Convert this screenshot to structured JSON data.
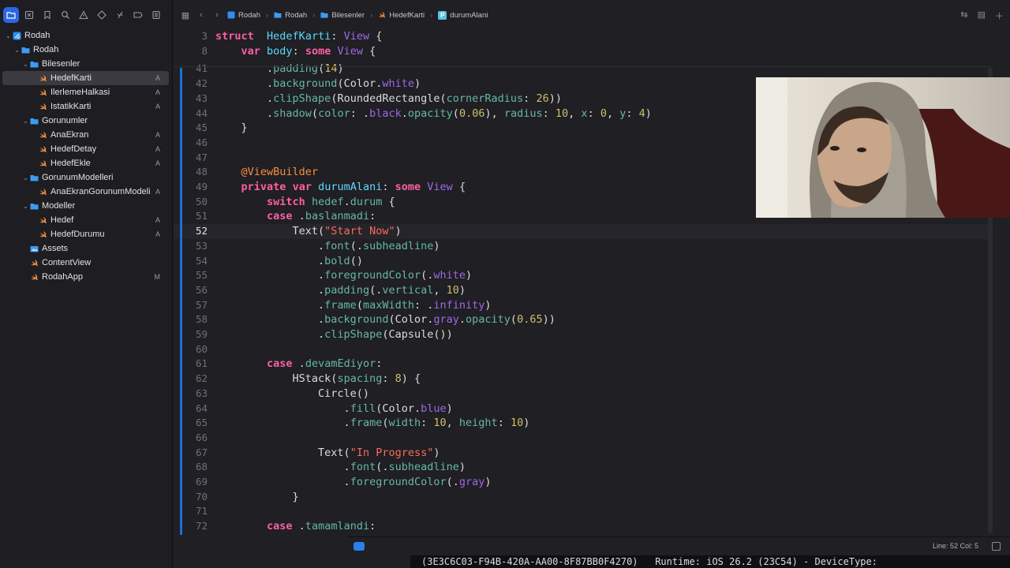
{
  "sidebar": {
    "toolbar_icons": [
      "folder-icon",
      "source-control-icon",
      "bookmark-icon",
      "find-icon",
      "issue-icon",
      "test-icon",
      "debug-icon",
      "breakpoint-icon",
      "report-icon"
    ],
    "tree": [
      {
        "label": "Rodah",
        "depth": 0,
        "kind": "project",
        "disclosure": "v",
        "badge": ""
      },
      {
        "label": "Rodah",
        "depth": 1,
        "kind": "folder",
        "disclosure": "v",
        "badge": ""
      },
      {
        "label": "Bilesenler",
        "depth": 2,
        "kind": "folder",
        "disclosure": "v",
        "badge": ""
      },
      {
        "label": "HedefKarti",
        "depth": 3,
        "kind": "swift",
        "disclosure": "",
        "badge": "A",
        "selected": true
      },
      {
        "label": "IlerlemeHalkasi",
        "depth": 3,
        "kind": "swift",
        "disclosure": "",
        "badge": "A"
      },
      {
        "label": "IstatikKarti",
        "depth": 3,
        "kind": "swift",
        "disclosure": "",
        "badge": "A"
      },
      {
        "label": "Gorunumler",
        "depth": 2,
        "kind": "folder",
        "disclosure": "v",
        "badge": ""
      },
      {
        "label": "AnaEkran",
        "depth": 3,
        "kind": "swift",
        "disclosure": "",
        "badge": "A"
      },
      {
        "label": "HedefDetay",
        "depth": 3,
        "kind": "swift",
        "disclosure": "",
        "badge": "A"
      },
      {
        "label": "HedefEkle",
        "depth": 3,
        "kind": "swift",
        "disclosure": "",
        "badge": "A"
      },
      {
        "label": "GorunumModelleri",
        "depth": 2,
        "kind": "folder",
        "disclosure": "v",
        "badge": ""
      },
      {
        "label": "AnaEkranGorunumModeli",
        "depth": 3,
        "kind": "swift",
        "disclosure": "",
        "badge": "A"
      },
      {
        "label": "Modeller",
        "depth": 2,
        "kind": "folder",
        "disclosure": "v",
        "badge": ""
      },
      {
        "label": "Hedef",
        "depth": 3,
        "kind": "swift",
        "disclosure": "",
        "badge": "A"
      },
      {
        "label": "HedefDurumu",
        "depth": 3,
        "kind": "swift",
        "disclosure": "",
        "badge": "A"
      },
      {
        "label": "Assets",
        "depth": 2,
        "kind": "assets",
        "disclosure": "",
        "badge": ""
      },
      {
        "label": "ContentView",
        "depth": 2,
        "kind": "swift",
        "disclosure": "",
        "badge": ""
      },
      {
        "label": "RodahApp",
        "depth": 2,
        "kind": "swift",
        "disclosure": "",
        "badge": "M"
      }
    ]
  },
  "jumpbar": {
    "crumbs": [
      {
        "label": "Rodah",
        "icon": "project-icon"
      },
      {
        "label": "Rodah",
        "icon": "folder-icon"
      },
      {
        "label": "Bilesenler",
        "icon": "folder-icon"
      },
      {
        "label": "HedefKarti",
        "icon": "swift-file-icon"
      },
      {
        "label": "durumAlani",
        "icon": "property-icon"
      }
    ],
    "property_glyph": "P"
  },
  "editor": {
    "current_line": "52",
    "lines": [
      {
        "n": "3",
        "sticky": true,
        "tokens": [
          [
            "kw",
            "struct"
          ],
          [
            "",
            "  "
          ],
          [
            "decl",
            "HedefKarti"
          ],
          [
            "",
            ": "
          ],
          [
            "ty",
            "View"
          ],
          [
            "",
            " {"
          ]
        ]
      },
      {
        "n": "8",
        "sticky": true,
        "tokens": [
          [
            "",
            "    "
          ],
          [
            "kw",
            "var"
          ],
          [
            "",
            ""
          ],
          [
            "",
            " "
          ],
          [
            "decl",
            "body"
          ],
          [
            "",
            ": "
          ],
          [
            "kw",
            "some"
          ],
          [
            "",
            " "
          ],
          [
            "ty",
            "View"
          ],
          [
            "",
            " {"
          ]
        ]
      },
      {
        "n": "41",
        "tokens": [
          [
            "",
            "        ."
          ],
          [
            "fn",
            "padding"
          ],
          [
            "",
            "("
          ],
          [
            "nm",
            "14"
          ],
          [
            "",
            ")"
          ]
        ]
      },
      {
        "n": "42",
        "tokens": [
          [
            "",
            "        ."
          ],
          [
            "fn",
            "background"
          ],
          [
            "",
            "(Color."
          ],
          [
            "pr",
            "white"
          ],
          [
            "",
            ")"
          ]
        ]
      },
      {
        "n": "43",
        "tokens": [
          [
            "",
            "        ."
          ],
          [
            "fn",
            "clipShape"
          ],
          [
            "",
            "(RoundedRectangle("
          ],
          [
            "fn",
            "cornerRadius"
          ],
          [
            "",
            ": "
          ],
          [
            "nm",
            "26"
          ],
          [
            "",
            "))"
          ]
        ]
      },
      {
        "n": "44",
        "tokens": [
          [
            "",
            "        ."
          ],
          [
            "fn",
            "shadow"
          ],
          [
            "",
            "("
          ],
          [
            "fn",
            "color"
          ],
          [
            "",
            ": ."
          ],
          [
            "pr",
            "black"
          ],
          [
            "",
            "."
          ],
          [
            "fn",
            "opacity"
          ],
          [
            "",
            "("
          ],
          [
            "nm",
            "0.06"
          ],
          [
            "",
            "), "
          ],
          [
            "fn",
            "radius"
          ],
          [
            "",
            ": "
          ],
          [
            "nm",
            "10"
          ],
          [
            "",
            ", "
          ],
          [
            "fn",
            "x"
          ],
          [
            "",
            ": "
          ],
          [
            "nm",
            "0"
          ],
          [
            "",
            ", "
          ],
          [
            "fn",
            "y"
          ],
          [
            "",
            ": "
          ],
          [
            "nm",
            "4"
          ],
          [
            "",
            ")"
          ]
        ]
      },
      {
        "n": "45",
        "tokens": [
          [
            "",
            "    }"
          ]
        ]
      },
      {
        "n": "46",
        "tokens": [
          [
            "",
            ""
          ]
        ]
      },
      {
        "n": "47",
        "tokens": [
          [
            "",
            ""
          ]
        ]
      },
      {
        "n": "48",
        "tokens": [
          [
            "",
            "    "
          ],
          [
            "at",
            "@ViewBuilder"
          ]
        ]
      },
      {
        "n": "49",
        "tokens": [
          [
            "",
            "    "
          ],
          [
            "kw",
            "private"
          ],
          [
            "",
            " "
          ],
          [
            "kw",
            "var"
          ],
          [
            "",
            " "
          ],
          [
            "decl",
            "durumAlani"
          ],
          [
            "",
            ": "
          ],
          [
            "kw",
            "some"
          ],
          [
            "",
            " "
          ],
          [
            "ty",
            "View"
          ],
          [
            "",
            " {"
          ]
        ]
      },
      {
        "n": "50",
        "tokens": [
          [
            "",
            "        "
          ],
          [
            "kw",
            "switch"
          ],
          [
            "",
            " "
          ],
          [
            "fn",
            "hedef"
          ],
          [
            "",
            "."
          ],
          [
            "fn",
            "durum"
          ],
          [
            "",
            " {"
          ]
        ]
      },
      {
        "n": "51",
        "tokens": [
          [
            "",
            "        "
          ],
          [
            "kw",
            "case"
          ],
          [
            "",
            " ."
          ],
          [
            "fn",
            "baslanmadi"
          ],
          [
            "",
            ":"
          ]
        ]
      },
      {
        "n": "52",
        "current": true,
        "tokens": [
          [
            "",
            "            Text("
          ],
          [
            "st",
            "\"Start Now\""
          ],
          [
            "",
            ")"
          ]
        ]
      },
      {
        "n": "53",
        "tokens": [
          [
            "",
            "                ."
          ],
          [
            "fn",
            "font"
          ],
          [
            "",
            "(."
          ],
          [
            "fn",
            "subheadline"
          ],
          [
            "",
            ")"
          ]
        ]
      },
      {
        "n": "54",
        "tokens": [
          [
            "",
            "                ."
          ],
          [
            "fn",
            "bold"
          ],
          [
            "",
            "()"
          ]
        ]
      },
      {
        "n": "55",
        "tokens": [
          [
            "",
            "                ."
          ],
          [
            "fn",
            "foregroundColor"
          ],
          [
            "",
            "(."
          ],
          [
            "pr",
            "white"
          ],
          [
            "",
            ")"
          ]
        ]
      },
      {
        "n": "56",
        "tokens": [
          [
            "",
            "                ."
          ],
          [
            "fn",
            "padding"
          ],
          [
            "",
            "(."
          ],
          [
            "fn",
            "vertical"
          ],
          [
            "",
            ", "
          ],
          [
            "nm",
            "10"
          ],
          [
            "",
            ")"
          ]
        ]
      },
      {
        "n": "57",
        "tokens": [
          [
            "",
            "                ."
          ],
          [
            "fn",
            "frame"
          ],
          [
            "",
            "("
          ],
          [
            "fn",
            "maxWidth"
          ],
          [
            "",
            ": ."
          ],
          [
            "pr",
            "infinity"
          ],
          [
            "",
            ")"
          ]
        ]
      },
      {
        "n": "58",
        "tokens": [
          [
            "",
            "                ."
          ],
          [
            "fn",
            "background"
          ],
          [
            "",
            "(Color."
          ],
          [
            "pr",
            "gray"
          ],
          [
            "",
            "."
          ],
          [
            "fn",
            "opacity"
          ],
          [
            "",
            "("
          ],
          [
            "nm",
            "0.65"
          ],
          [
            "",
            "))"
          ]
        ]
      },
      {
        "n": "59",
        "tokens": [
          [
            "",
            "                ."
          ],
          [
            "fn",
            "clipShape"
          ],
          [
            "",
            "(Capsule())"
          ]
        ]
      },
      {
        "n": "60",
        "tokens": [
          [
            "",
            ""
          ]
        ]
      },
      {
        "n": "61",
        "tokens": [
          [
            "",
            "        "
          ],
          [
            "kw",
            "case"
          ],
          [
            "",
            " ."
          ],
          [
            "fn",
            "devamEdiyor"
          ],
          [
            "",
            ":"
          ]
        ]
      },
      {
        "n": "62",
        "tokens": [
          [
            "",
            "            HStack("
          ],
          [
            "fn",
            "spacing"
          ],
          [
            "",
            ": "
          ],
          [
            "nm",
            "8"
          ],
          [
            "",
            ") {"
          ]
        ]
      },
      {
        "n": "63",
        "tokens": [
          [
            "",
            "                Circle()"
          ]
        ]
      },
      {
        "n": "64",
        "tokens": [
          [
            "",
            "                    ."
          ],
          [
            "fn",
            "fill"
          ],
          [
            "",
            "(Color."
          ],
          [
            "pr",
            "blue"
          ],
          [
            "",
            ")"
          ]
        ]
      },
      {
        "n": "65",
        "tokens": [
          [
            "",
            "                    ."
          ],
          [
            "fn",
            "frame"
          ],
          [
            "",
            "("
          ],
          [
            "fn",
            "width"
          ],
          [
            "",
            ": "
          ],
          [
            "nm",
            "10"
          ],
          [
            "",
            ", "
          ],
          [
            "fn",
            "height"
          ],
          [
            "",
            ": "
          ],
          [
            "nm",
            "10"
          ],
          [
            "",
            ")"
          ]
        ]
      },
      {
        "n": "66",
        "tokens": [
          [
            "",
            ""
          ]
        ]
      },
      {
        "n": "67",
        "tokens": [
          [
            "",
            "                Text("
          ],
          [
            "st",
            "\"In Progress\""
          ],
          [
            "",
            ")"
          ]
        ]
      },
      {
        "n": "68",
        "tokens": [
          [
            "",
            "                    ."
          ],
          [
            "fn",
            "font"
          ],
          [
            "",
            "(."
          ],
          [
            "fn",
            "subheadline"
          ],
          [
            "",
            ")"
          ]
        ]
      },
      {
        "n": "69",
        "tokens": [
          [
            "",
            "                    ."
          ],
          [
            "fn",
            "foregroundColor"
          ],
          [
            "",
            "(."
          ],
          [
            "pr",
            "gray"
          ],
          [
            "",
            ")"
          ]
        ]
      },
      {
        "n": "70",
        "tokens": [
          [
            "",
            "            }"
          ]
        ]
      },
      {
        "n": "71",
        "tokens": [
          [
            "",
            ""
          ]
        ]
      },
      {
        "n": "72",
        "tokens": [
          [
            "",
            "        "
          ],
          [
            "kw",
            "case"
          ],
          [
            "",
            " ."
          ],
          [
            "fn",
            "tamamlandi"
          ],
          [
            "",
            ":"
          ]
        ]
      }
    ]
  },
  "statusbar": {
    "line_col": "Line: 52  Col: 5"
  },
  "console": {
    "text": "(3E3C6C03-F94B-420A-AA00-8F87BB0F4270)   Runtime: iOS 26.2 (23C54) - DeviceType:"
  },
  "colors": {
    "accent": "#2a67e4",
    "keyword": "#fc5fa3",
    "type": "#a167e6",
    "function": "#67b7a4",
    "string": "#fc6a5d",
    "number": "#d0bf69",
    "attribute": "#fd8f3f",
    "swift": "#f08a3c",
    "folder": "#3c9cf4"
  }
}
